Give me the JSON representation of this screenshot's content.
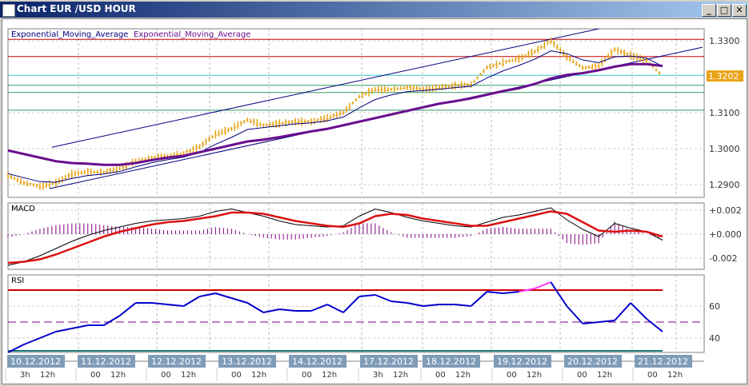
{
  "window": {
    "title": "Chart EUR /USD  HOUR",
    "min": "_",
    "max": "□",
    "close": "✕"
  },
  "legend": {
    "ema1": "Exponential_Moving_Average",
    "ema2": "Exponential_Moving_Average"
  },
  "colors": {
    "candle": "#e8a317",
    "ema_fast": "#000080",
    "ema_slow": "#6a0f8e",
    "red": "#cc0000",
    "cyan": "#33cccc",
    "green": "#339966",
    "rsi": "#0000cc",
    "rsi_hot": "#ff33ff",
    "macd": "#000000",
    "signal": "#dd1111",
    "date_bg": "#7f9cb8"
  },
  "chart_data": [
    {
      "type": "line",
      "title": "EUR/USD HOUR",
      "ylim": [
        1.286,
        1.334
      ],
      "yticks": [
        "1.3300",
        "1.3100",
        "1.3000",
        "1.2900"
      ],
      "ytick_values": [
        1.33,
        1.31,
        1.3,
        1.29
      ],
      "current_price": "1.3202",
      "price": [
        1.2925,
        1.2905,
        1.2895,
        1.2905,
        1.293,
        1.2935,
        1.2935,
        1.2945,
        1.2965,
        1.2975,
        1.298,
        1.2985,
        1.3005,
        1.304,
        1.3055,
        1.308,
        1.3065,
        1.307,
        1.3075,
        1.3075,
        1.3085,
        1.31,
        1.3145,
        1.3165,
        1.3165,
        1.317,
        1.3165,
        1.317,
        1.3175,
        1.3178,
        1.3225,
        1.324,
        1.325,
        1.327,
        1.33,
        1.3255,
        1.3225,
        1.323,
        1.3275,
        1.326,
        1.3245,
        1.3202
      ],
      "ema_slow": [
        1.2995,
        1.2985,
        1.2975,
        1.2965,
        1.296,
        1.2958,
        1.2955,
        1.2955,
        1.296,
        1.2968,
        1.2975,
        1.298,
        1.299,
        1.3,
        1.301,
        1.302,
        1.3025,
        1.3032,
        1.304,
        1.3048,
        1.3055,
        1.3065,
        1.3075,
        1.3085,
        1.3095,
        1.3105,
        1.3115,
        1.3125,
        1.3132,
        1.314,
        1.315,
        1.316,
        1.3168,
        1.318,
        1.3195,
        1.3205,
        1.321,
        1.3218,
        1.3228,
        1.3235,
        1.3235,
        1.323
      ],
      "hlines": [
        1.3304,
        1.3256,
        1.3204,
        1.3176,
        1.3156,
        1.3107
      ],
      "trendlines": [
        [
          [
            2.75,
            1.3004
          ],
          [
            37.5,
            1.3338
          ]
        ],
        [
          [
            2.6,
            1.2889
          ],
          [
            43.5,
            1.3282
          ]
        ]
      ]
    },
    {
      "type": "line",
      "title": "MACD",
      "ylim": [
        -0.003,
        0.003
      ],
      "yticks": [
        "+0.002",
        "+0.000",
        "-0.002"
      ],
      "ytick_values": [
        0.002,
        0,
        -0.002
      ],
      "macd": [
        -0.0026,
        -0.0023,
        -0.0018,
        -0.0012,
        -0.0006,
        -0.0001,
        0.0003,
        0.0006,
        0.0009,
        0.0011,
        0.0012,
        0.0013,
        0.0015,
        0.0019,
        0.0021,
        0.0018,
        0.0015,
        0.0011,
        0.0008,
        0.0007,
        0.0006,
        0.0007,
        0.0015,
        0.0021,
        0.0018,
        0.0014,
        0.0011,
        0.0009,
        0.0007,
        0.0006,
        0.001,
        0.0014,
        0.0016,
        0.0019,
        0.0022,
        0.0012,
        0.0004,
        -0.0002,
        0.0009,
        0.0005,
        0.0002,
        -0.0005
      ],
      "signal": [
        -0.0024,
        -0.0023,
        -0.0021,
        -0.0017,
        -0.0012,
        -0.0007,
        -0.0002,
        0.0002,
        0.0005,
        0.0008,
        0.001,
        0.0011,
        0.0013,
        0.0015,
        0.0018,
        0.0018,
        0.0017,
        0.0014,
        0.0011,
        0.0009,
        0.0007,
        0.0006,
        0.0009,
        0.0015,
        0.0017,
        0.0016,
        0.0013,
        0.0011,
        0.0009,
        0.0007,
        0.0007,
        0.001,
        0.0013,
        0.0016,
        0.0019,
        0.0017,
        0.001,
        0.0003,
        0.0002,
        0.0003,
        0.0002,
        -0.0002
      ]
    },
    {
      "type": "line",
      "title": "RSI",
      "ylim": [
        30,
        80
      ],
      "yticks": [
        "60",
        "40"
      ],
      "ytick_values": [
        60,
        40
      ],
      "levels": [
        70,
        50,
        30
      ],
      "rsi": [
        31,
        36,
        40,
        44,
        46,
        48,
        48,
        54,
        62,
        62,
        61,
        60,
        66,
        68,
        65,
        62,
        56,
        58,
        57,
        57,
        61,
        56,
        66,
        67,
        63,
        62,
        60,
        61,
        61,
        60,
        69,
        68,
        69,
        71,
        75,
        60,
        49,
        50,
        51,
        62,
        52,
        44
      ]
    }
  ],
  "time_axis": {
    "dates": [
      "10.12.2012",
      "11.12.2012",
      "12.12.2012",
      "13.12.2012",
      "14.12.2012",
      "17.12.2012",
      "18.12.2012",
      "19.12.2012",
      "20.12.2012",
      "21.12.2012"
    ],
    "hours": [
      [
        "3h",
        "12h"
      ],
      [
        "00",
        "12h"
      ],
      [
        "00",
        "12h"
      ],
      [
        "00",
        "12h"
      ],
      [
        "00",
        "12h"
      ],
      [
        "3h",
        "12h"
      ],
      [
        "00",
        "12h"
      ],
      [
        "00",
        "12h"
      ],
      [
        "00",
        "12h"
      ],
      [
        "00",
        "12h"
      ]
    ]
  }
}
